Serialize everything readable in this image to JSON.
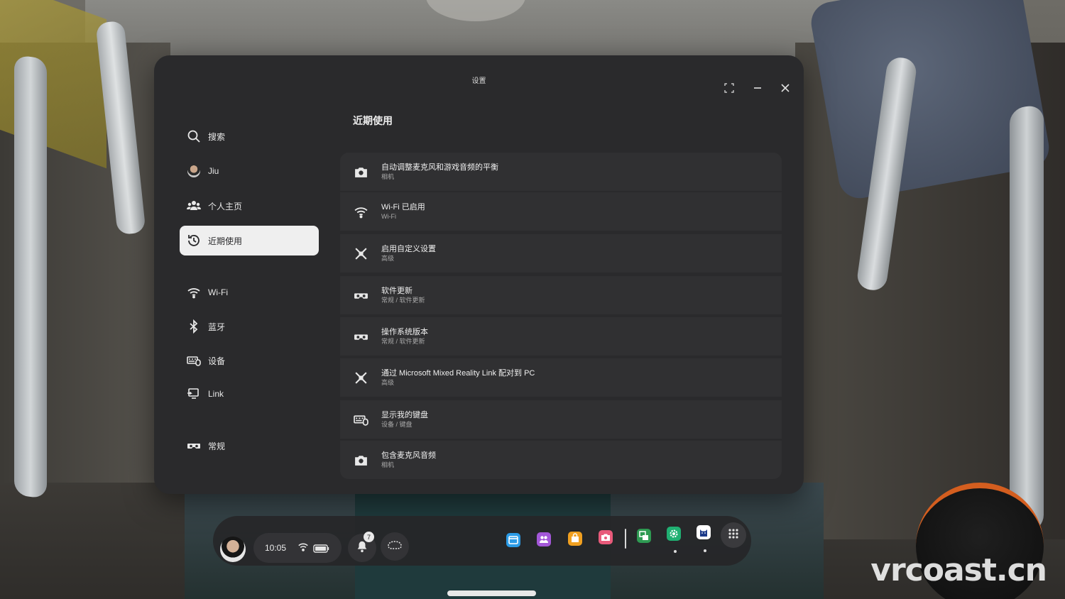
{
  "window": {
    "title": "设置"
  },
  "nav": {
    "search": "搜索",
    "user": "Jiu",
    "profile": "个人主页",
    "recent": "近期使用",
    "wifi": "Wi-Fi",
    "bluetooth": "蓝牙",
    "devices": "设备",
    "link": "Link",
    "general": "常规"
  },
  "main": {
    "section_title": "近期使用",
    "items": [
      {
        "title": "自动调整麦克风和游戏音频的平衡",
        "subtitle": "相机",
        "icon": "camera-icon"
      },
      {
        "title": "Wi-Fi 已启用",
        "subtitle": "Wi-Fi",
        "icon": "wifi-icon"
      },
      {
        "title": "启用自定义设置",
        "subtitle": "高级",
        "icon": "advanced-icon"
      },
      {
        "title": "软件更新",
        "subtitle": "常规 / 软件更新",
        "icon": "headset-icon"
      },
      {
        "title": "操作系统版本",
        "subtitle": "常规 / 软件更新",
        "icon": "headset-icon"
      },
      {
        "title": "通过 Microsoft Mixed Reality Link 配对到 PC",
        "subtitle": "高级",
        "icon": "advanced-icon"
      },
      {
        "title": "显示我的键盘",
        "subtitle": "设备 / 键盘",
        "icon": "devices-icon"
      },
      {
        "title": "包含麦克风音频",
        "subtitle": "相机",
        "icon": "camera-icon"
      }
    ]
  },
  "taskbar": {
    "time": "10:05",
    "notification_count": "7",
    "apps": [
      {
        "name": "browser-app",
        "color": "#2b9be6"
      },
      {
        "name": "people-app",
        "color": "#a357d8"
      },
      {
        "name": "store-app",
        "color": "#f0a020"
      },
      {
        "name": "camera-app",
        "color": "#e85a7a"
      },
      {
        "name": "files-app",
        "color": "#2e9a52"
      },
      {
        "name": "settings-app",
        "color": "#20b072"
      },
      {
        "name": "cat-app",
        "color": "#ffffff"
      }
    ]
  },
  "watermark": "vrcoast.cn"
}
